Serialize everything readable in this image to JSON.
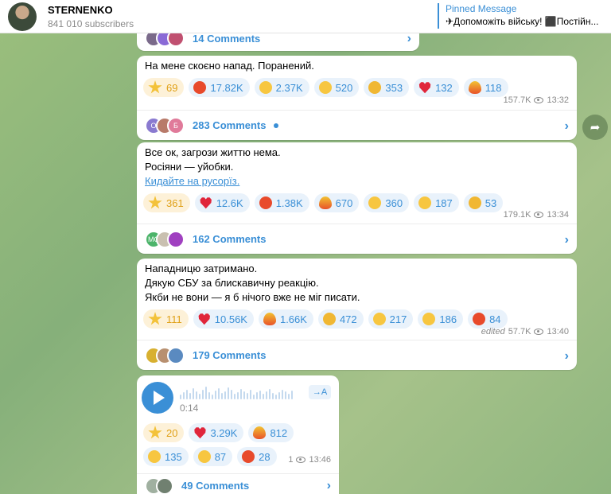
{
  "header": {
    "channel_name": "STERNENKO",
    "subscribers": "841 010 subscribers",
    "pinned_title": "Pinned Message",
    "pinned_text": "✈Допоможіть війську! ⬛Постійн..."
  },
  "messages": [
    {
      "comments_label": "14 Comments"
    },
    {
      "text": [
        "На мене скоєно напад. Поранений."
      ],
      "reactions": [
        {
          "icon": "star-icon",
          "count": "69"
        },
        {
          "icon": "angry-face-icon",
          "count": "17.82K"
        },
        {
          "icon": "crying-face-icon",
          "count": "2.37K"
        },
        {
          "icon": "grinning-face-icon",
          "count": "520"
        },
        {
          "icon": "thinking-face-icon",
          "count": "353"
        },
        {
          "icon": "heart-icon",
          "count": "132"
        },
        {
          "icon": "fire-icon",
          "count": "118"
        }
      ],
      "views": "157.7K",
      "time": "13:32",
      "comments_label": "283 Comments",
      "avatars": [
        "О",
        "Б"
      ]
    },
    {
      "text": [
        "Все ок, загрози життю нема.",
        "Росіяни — уйобки."
      ],
      "link_text": "Кидайте на русорїз.",
      "reactions": [
        {
          "icon": "star-icon",
          "count": "361"
        },
        {
          "icon": "heart-icon",
          "count": "12.6K"
        },
        {
          "icon": "angry-face-icon",
          "count": "1.38K"
        },
        {
          "icon": "fire-icon",
          "count": "670"
        },
        {
          "icon": "grinning-face-icon",
          "count": "360"
        },
        {
          "icon": "crying-face-icon",
          "count": "187"
        },
        {
          "icon": "thinking-face-icon",
          "count": "53"
        }
      ],
      "views": "179.1K",
      "time": "13:34",
      "comments_label": "162 Comments",
      "avatars": [
        "МС"
      ]
    },
    {
      "text": [
        "Нападницю затримано.",
        "Дякую СБУ за блискавичну реакцію.",
        "Якби не вони — я б нічого вже не міг писати."
      ],
      "reactions": [
        {
          "icon": "star-icon",
          "count": "111"
        },
        {
          "icon": "heart-icon",
          "count": "10.56K"
        },
        {
          "icon": "fire-icon",
          "count": "1.66K"
        },
        {
          "icon": "thinking-face-icon",
          "count": "472"
        },
        {
          "icon": "crying-face-icon",
          "count": "217"
        },
        {
          "icon": "grinning-face-icon",
          "count": "186"
        },
        {
          "icon": "angry-face-icon",
          "count": "84"
        }
      ],
      "edited": "edited",
      "views": "57.7K",
      "time": "13:40",
      "comments_label": "179 Comments"
    },
    {
      "voice": {
        "duration": "0:14",
        "transcribe_label": "→A"
      },
      "reactions": [
        {
          "icon": "star-icon",
          "count": "20"
        },
        {
          "icon": "heart-icon",
          "count": "3.29K"
        },
        {
          "icon": "fire-icon",
          "count": "812"
        },
        {
          "icon": "crying-face-icon",
          "count": "135"
        },
        {
          "icon": "grinning-face-icon",
          "count": "87"
        },
        {
          "icon": "angry-face-icon",
          "count": "28"
        }
      ],
      "views": "1",
      "time": "13:46",
      "comments_label": "49 Comments"
    }
  ],
  "colors": {
    "accent": "#3a8fd6",
    "background": "#9bbf7d"
  }
}
